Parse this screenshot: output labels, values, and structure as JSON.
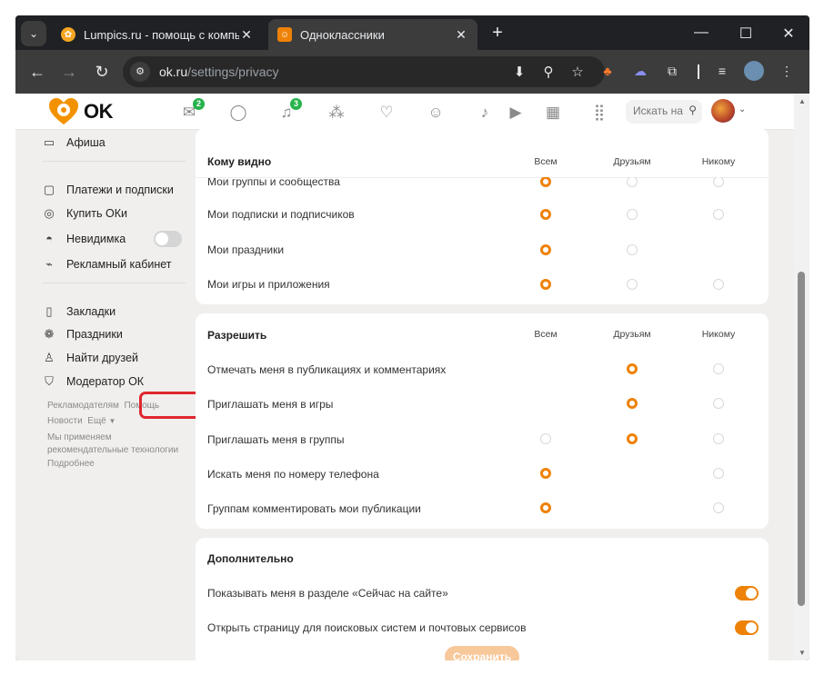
{
  "browser": {
    "tabs": [
      {
        "title": "Lumpics.ru - помощь с компью",
        "active": false,
        "favicon": "orange-circle-icon"
      },
      {
        "title": "Одноклассники",
        "active": true,
        "favicon": "ok-logo-icon"
      }
    ],
    "url_host": "ok.ru",
    "url_path": "/settings/privacy"
  },
  "header": {
    "logo_text": "OK",
    "messages_badge": "2",
    "notifications_badge": "3",
    "search_placeholder": "Искать на",
    "icons": [
      "mail-icon",
      "chat-icon",
      "bell-icon",
      "guests-icon",
      "like-icon",
      "friends-icon",
      "music-icon",
      "video-icon",
      "calendar-icon",
      "apps-grid-icon"
    ]
  },
  "sidebar": {
    "items": [
      {
        "label": "Афиша",
        "icon": "ticket-icon"
      },
      {
        "label": "Платежи и подписки",
        "icon": "wallet-icon"
      },
      {
        "label": "Купить ОКи",
        "icon": "coin-icon"
      },
      {
        "label": "Невидимка",
        "icon": "incognito-icon"
      },
      {
        "label": "Рекламный кабинет",
        "icon": "megaphone-icon"
      },
      {
        "label": "Закладки",
        "icon": "bookmark-icon"
      },
      {
        "label": "Праздники",
        "icon": "gift-icon"
      },
      {
        "label": "Найти друзей",
        "icon": "add-friend-icon"
      },
      {
        "label": "Модератор ОК",
        "icon": "shield-icon"
      }
    ],
    "footer": {
      "advertisers": "Рекламодателям",
      "help": "Помощь",
      "news": "Новости",
      "more": "Ещё",
      "recommend_line1": "Мы применяем",
      "recommend_line2": "рекомендательные технологии",
      "details": "Подробнее"
    }
  },
  "privacy": {
    "columns": [
      "Всем",
      "Друзьям",
      "Никому"
    ],
    "visible": {
      "title": "Кому видно",
      "rows": [
        {
          "label": "Мои группы и сообщества",
          "selected": 0
        },
        {
          "label": "Мои подписки и подписчиков",
          "selected": 0
        },
        {
          "label": "Мои праздники",
          "selected": 0
        },
        {
          "label": "Мои игры и приложения",
          "selected": 0
        }
      ]
    },
    "allow": {
      "title": "Разрешить",
      "rows": [
        {
          "label": "Отмечать меня в публикациях и комментариях",
          "selected": 1
        },
        {
          "label": "Приглашать меня в игры",
          "selected": 1
        },
        {
          "label": "Приглашать меня в группы",
          "selected": 1
        },
        {
          "label": "Искать меня по номеру телефона",
          "selected": 0
        },
        {
          "label": "Группам комментировать мои публикации",
          "selected": 0
        }
      ]
    },
    "extra": {
      "title": "Дополнительно",
      "rows": [
        {
          "label": "Показывать меня в разделе «Сейчас на сайте»",
          "enabled": true
        },
        {
          "label": "Открыть страницу для поисковых систем и почтовых сервисов",
          "enabled": true
        }
      ]
    },
    "save_label": "Сохранить"
  },
  "colors": {
    "accent": "#ee8208",
    "badge": "#26b34b",
    "highlight": "#e0262e"
  }
}
